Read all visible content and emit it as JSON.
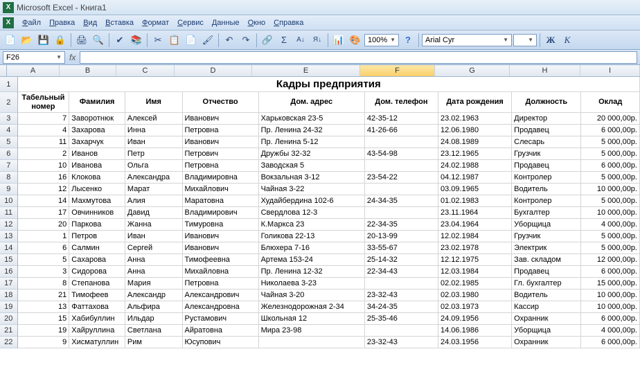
{
  "window": {
    "title": "Microsoft Excel - Книга1"
  },
  "menu": [
    "Файл",
    "Правка",
    "Вид",
    "Вставка",
    "Формат",
    "Сервис",
    "Данные",
    "Окно",
    "Справка"
  ],
  "toolbar": {
    "zoom": "100%",
    "font": "Arial Cyr"
  },
  "formula": {
    "name": "F26",
    "value": ""
  },
  "cols": [
    "A",
    "B",
    "C",
    "D",
    "E",
    "F",
    "G",
    "H",
    "I"
  ],
  "title": "Кадры предприятия",
  "headers": [
    "Табельный номер",
    "Фамилия",
    "Имя",
    "Отчество",
    "Дом. адрес",
    "Дом. телефон",
    "Дата рождения",
    "Должность",
    "Оклад"
  ],
  "rows": [
    {
      "n": "7",
      "f": "Заворотнюк",
      "i": "Алексей",
      "o": "Иванович",
      "a": "Харьковская 23-5",
      "t": "42-35-12",
      "d": "23.02.1963",
      "p": "Директор",
      "s": "20 000,00р."
    },
    {
      "n": "4",
      "f": "Захарова",
      "i": "Инна",
      "o": "Петровна",
      "a": "Пр. Ленина 24-32",
      "t": "41-26-66",
      "d": "12.06.1980",
      "p": "Продавец",
      "s": "6 000,00р."
    },
    {
      "n": "11",
      "f": "Захарчук",
      "i": "Иван",
      "o": "Иванович",
      "a": "Пр. Ленина 5-12",
      "t": "",
      "d": "24.08.1989",
      "p": "Слесарь",
      "s": "5 000,00р."
    },
    {
      "n": "2",
      "f": "Иванов",
      "i": "Петр",
      "o": "Петрович",
      "a": "Дружбы 32-32",
      "t": "43-54-98",
      "d": "23.12.1965",
      "p": "Грузчик",
      "s": "5 000,00р."
    },
    {
      "n": "10",
      "f": "Иванова",
      "i": "Ольга",
      "o": "Петровна",
      "a": "Заводская 5",
      "t": "",
      "d": "24.02.1988",
      "p": "Продавец",
      "s": "6 000,00р."
    },
    {
      "n": "16",
      "f": "Клокова",
      "i": "Александра",
      "o": "Владимировна",
      "a": "Вокзальная 3-12",
      "t": "23-54-22",
      "d": "04.12.1987",
      "p": "Контролер",
      "s": "5 000,00р."
    },
    {
      "n": "12",
      "f": "Лысенко",
      "i": "Марат",
      "o": "Михайлович",
      "a": "Чайная 3-22",
      "t": "",
      "d": "03.09.1965",
      "p": "Водитель",
      "s": "10 000,00р."
    },
    {
      "n": "14",
      "f": "Махмутова",
      "i": "Алия",
      "o": "Маратовна",
      "a": "Худайбердина 102-6",
      "t": "24-34-35",
      "d": "01.02.1983",
      "p": "Контролер",
      "s": "5 000,00р."
    },
    {
      "n": "17",
      "f": "Овчинников",
      "i": "Давид",
      "o": "Владимирович",
      "a": "Свердлова 12-3",
      "t": "",
      "d": "23.11.1964",
      "p": "Бухгалтер",
      "s": "10 000,00р."
    },
    {
      "n": "20",
      "f": "Паркова",
      "i": "Жанна",
      "o": "Тимуровна",
      "a": "К.Маркса 23",
      "t": "22-34-35",
      "d": "23.04.1964",
      "p": "Уборщица",
      "s": "4 000,00р."
    },
    {
      "n": "1",
      "f": "Петров",
      "i": "Иван",
      "o": "Иванович",
      "a": "Голикова 22-13",
      "t": "20-13-99",
      "d": "12.02.1984",
      "p": "Грузчик",
      "s": "5 000,00р."
    },
    {
      "n": "6",
      "f": "Салмин",
      "i": "Сергей",
      "o": "Иванович",
      "a": "Блюхера 7-16",
      "t": "33-55-67",
      "d": "23.02.1978",
      "p": "Электрик",
      "s": "5 000,00р."
    },
    {
      "n": "5",
      "f": "Сахарова",
      "i": "Анна",
      "o": "Тимофеевна",
      "a": "Артема 153-24",
      "t": "25-14-32",
      "d": "12.12.1975",
      "p": "Зав. складом",
      "s": "12 000,00р."
    },
    {
      "n": "3",
      "f": "Сидорова",
      "i": "Анна",
      "o": "Михайловна",
      "a": "Пр. Ленина 12-32",
      "t": "22-34-43",
      "d": "12.03.1984",
      "p": "Продавец",
      "s": "6 000,00р."
    },
    {
      "n": "8",
      "f": "Степанова",
      "i": "Мария",
      "o": "Петровна",
      "a": "Николаева 3-23",
      "t": "",
      "d": "02.02.1985",
      "p": "Гл. бухгалтер",
      "s": "15 000,00р."
    },
    {
      "n": "21",
      "f": "Тимофеев",
      "i": "Александр",
      "o": "Александрович",
      "a": "Чайная 3-20",
      "t": "23-32-43",
      "d": "02.03.1980",
      "p": "Водитель",
      "s": "10 000,00р."
    },
    {
      "n": "13",
      "f": "Фаттахова",
      "i": "Альфира",
      "o": "Александровна",
      "a": "Железнодорожная 2-34",
      "t": "34-24-35",
      "d": "02.03.1973",
      "p": "Кассир",
      "s": "10 000,00р."
    },
    {
      "n": "15",
      "f": "Хабибуллин",
      "i": "Ильдар",
      "o": "Рустамович",
      "a": "Школьная 12",
      "t": "25-35-46",
      "d": "24.09.1956",
      "p": "Охранник",
      "s": "6 000,00р."
    },
    {
      "n": "19",
      "f": "Хайруллина",
      "i": "Светлана",
      "o": "Айратовна",
      "a": "Мира 23-98",
      "t": "",
      "d": "14.06.1986",
      "p": "Уборщица",
      "s": "4 000,00р."
    },
    {
      "n": "9",
      "f": "Хисматуллин",
      "i": "Рим",
      "o": "Юсупович",
      "a": "",
      "t": "23-32-43",
      "d": "24.03.1956",
      "p": "Охранник",
      "s": "6 000,00р."
    }
  ]
}
